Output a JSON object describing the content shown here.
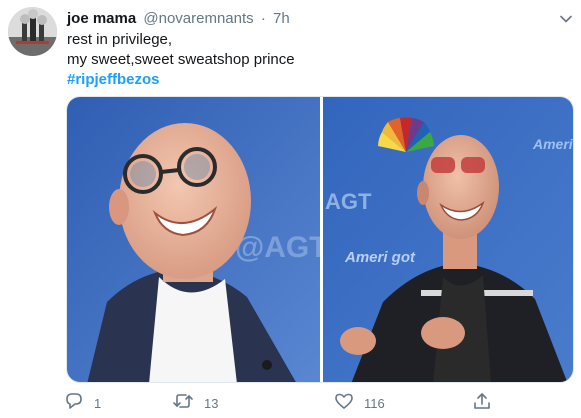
{
  "tweet": {
    "display_name": "joe mama",
    "handle": "@novaremnants",
    "separator": "·",
    "time": "7h",
    "text_lines": [
      "rest in privilege,",
      "my sweet,sweet sweatshop prince"
    ],
    "hashtag": "#ripjeffbezos",
    "media": {
      "left_photo_backdrop_text": "@AGT",
      "right_photo_backdrop_texts": [
        "America's got",
        "AGT",
        "Ameri got"
      ]
    },
    "actions": {
      "reply_count": "1",
      "retweet_count": "13",
      "like_count": "116"
    }
  },
  "colors": {
    "link": "#1da1f2",
    "secondary_text": "#657786",
    "primary_text": "#14171a",
    "backdrop_blue": "#3f6fc1"
  },
  "icons": [
    "avatar",
    "chevron-down-icon",
    "reply-icon",
    "retweet-icon",
    "like-icon",
    "share-icon"
  ]
}
